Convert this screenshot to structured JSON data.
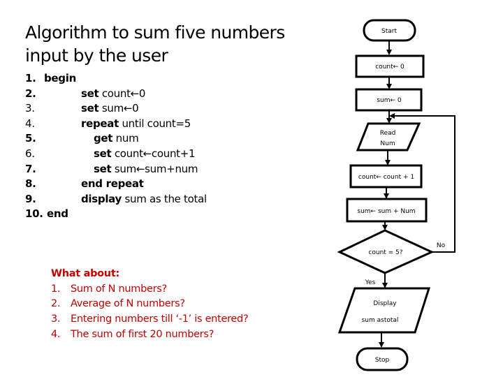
{
  "title": {
    "line1": "Algorithm to sum five numbers",
    "line2": "input by the user"
  },
  "algorithm": {
    "steps": [
      {
        "num": "1.",
        "num_bold": true,
        "keyword": "begin",
        "rest": ""
      },
      {
        "num": "2.",
        "num_bold": true,
        "keyword": "set",
        "rest": " count←0"
      },
      {
        "num": "3.",
        "num_bold": false,
        "keyword": "set",
        "rest": " sum←0"
      },
      {
        "num": "4.",
        "num_bold": false,
        "keyword": "repeat",
        "rest": " until count=5"
      },
      {
        "num": "5.",
        "num_bold": true,
        "keyword": "get",
        "rest": " num"
      },
      {
        "num": "6.",
        "num_bold": false,
        "keyword": "set",
        "rest": " count←count+1"
      },
      {
        "num": "7.",
        "num_bold": true,
        "keyword": "set",
        "rest": " sum←sum+num"
      },
      {
        "num": "8.",
        "num_bold": true,
        "keyword": "end repeat",
        "rest": ""
      },
      {
        "num": "9.",
        "num_bold": true,
        "keyword": "display",
        "rest": " sum as the total"
      },
      {
        "num": "10.",
        "num_bold": true,
        "keyword": "end",
        "rest": ""
      }
    ]
  },
  "questions": {
    "heading": "What about:",
    "items": [
      {
        "num": "1.",
        "text": "Sum of N numbers?"
      },
      {
        "num": "2.",
        "text": "Average of N numbers?"
      },
      {
        "num": "3.",
        "text": "Entering numbers till ‘-1’ is entered?"
      },
      {
        "num": "4.",
        "text": "The sum of first 20 numbers?"
      }
    ],
    "color": "#c00000"
  },
  "flowchart": {
    "start": "Start",
    "init_count": "count← 0",
    "init_sum": "sum← 0",
    "read_line1": "Read",
    "read_line2": "Num",
    "increment": "count← count + 1",
    "accumulate": "sum← sum + Num",
    "decision": "count = 5?",
    "no_label": "No",
    "yes_label": "Yes",
    "display_line1": "Display",
    "display_line2": "sum astotal",
    "stop": "Stop"
  }
}
